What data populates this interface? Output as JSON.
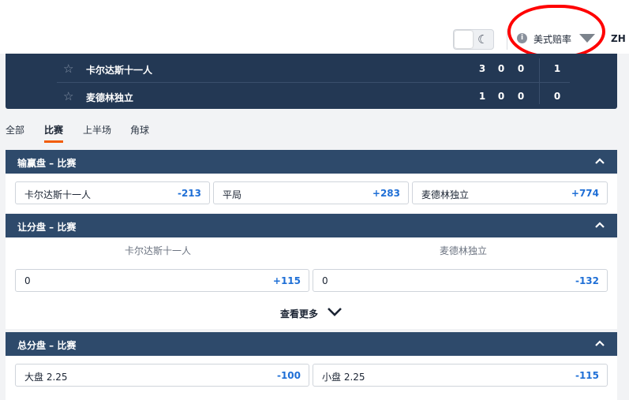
{
  "header": {
    "odds_format": "美式赔率",
    "language": "ZH",
    "info_icon": "info-icon",
    "moon_icon": "moon-icon"
  },
  "scoreboard": {
    "teams": [
      {
        "name": "卡尔达斯十一人",
        "scores": [
          "3",
          "0",
          "0"
        ],
        "total": "1"
      },
      {
        "name": "麦德林独立",
        "scores": [
          "1",
          "0",
          "0"
        ],
        "total": "0"
      }
    ]
  },
  "tabs": [
    {
      "label": "全部"
    },
    {
      "label": "比赛"
    },
    {
      "label": "上半场"
    },
    {
      "label": "角球"
    }
  ],
  "markets": {
    "moneyline": {
      "title": "输赢盘 – 比赛",
      "outcomes": [
        {
          "label": "卡尔达斯十一人",
          "price": "-213"
        },
        {
          "label": "平局",
          "price": "+283"
        },
        {
          "label": "麦德林独立",
          "price": "+774"
        }
      ]
    },
    "handicap": {
      "title": "让分盘 – 比赛",
      "columns": [
        "卡尔达斯十一人",
        "麦德林独立"
      ],
      "outcomes": [
        {
          "label": "0",
          "price": "+115"
        },
        {
          "label": "0",
          "price": "-132"
        }
      ],
      "see_more": "查看更多"
    },
    "totals": {
      "title": "总分盘 – 比赛",
      "outcomes": [
        {
          "label": "大盘 2.25",
          "price": "-100"
        },
        {
          "label": "小盘 2.25",
          "price": "-115"
        }
      ]
    }
  },
  "colors": {
    "accent": "#f25c05",
    "price": "#1f6fd6",
    "header_bg": "#2e4a6b",
    "scoreboard_bg": "#233854",
    "annotation": "#ff0000"
  }
}
